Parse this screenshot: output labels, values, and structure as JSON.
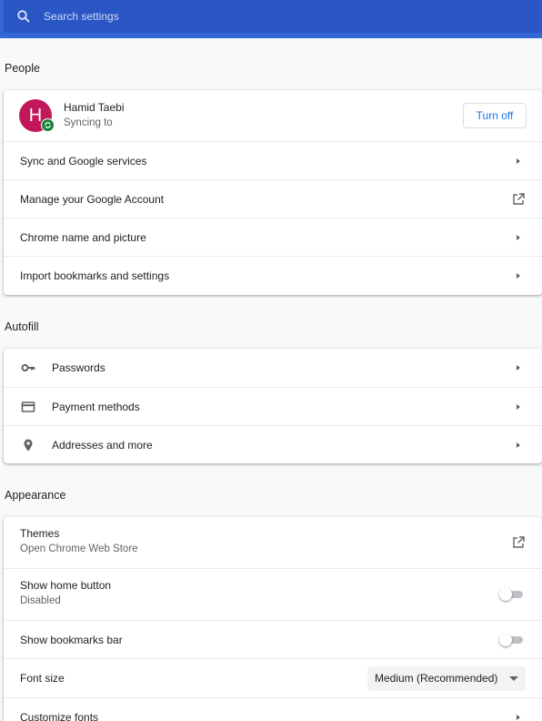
{
  "search": {
    "placeholder": "Search settings"
  },
  "people": {
    "title": "People",
    "profile": {
      "name": "Hamid Taebi",
      "status": "Syncing to",
      "avatar_letter": "H",
      "avatar_color": "#c2185b"
    },
    "turn_off_label": "Turn off",
    "items": [
      {
        "label": "Sync and Google services",
        "action": "arrow"
      },
      {
        "label": "Manage your Google Account",
        "action": "external-link"
      },
      {
        "label": "Chrome name and picture",
        "action": "arrow"
      },
      {
        "label": "Import bookmarks and settings",
        "action": "arrow"
      }
    ]
  },
  "autofill": {
    "title": "Autofill",
    "items": [
      {
        "label": "Passwords",
        "icon": "key-icon"
      },
      {
        "label": "Payment methods",
        "icon": "credit-card-icon"
      },
      {
        "label": "Addresses and more",
        "icon": "location-pin-icon"
      }
    ]
  },
  "appearance": {
    "title": "Appearance",
    "themes": {
      "label": "Themes",
      "sub": "Open Chrome Web Store"
    },
    "home_button": {
      "label": "Show home button",
      "sub": "Disabled",
      "enabled": false
    },
    "bookmarks_bar": {
      "label": "Show bookmarks bar",
      "enabled": false
    },
    "font_size": {
      "label": "Font size",
      "value": "Medium (Recommended)"
    },
    "customize_fonts": {
      "label": "Customize fonts"
    }
  },
  "colors": {
    "header": "#3367d6",
    "search": "#2a56c6",
    "accent": "#1a73e8",
    "sync_badge": "#188038"
  }
}
